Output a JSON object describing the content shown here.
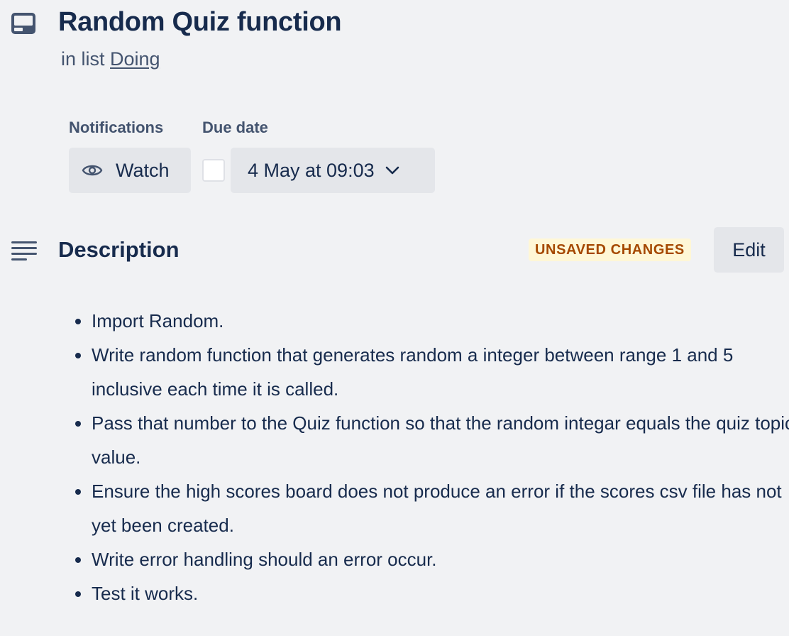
{
  "card": {
    "title": "Random Quiz function",
    "in_list_prefix": "in list",
    "list_name": "Doing",
    "icon": "card-icon"
  },
  "notifications": {
    "label": "Notifications",
    "watch_label": "Watch",
    "icon": "eye-icon"
  },
  "due_date": {
    "label": "Due date",
    "value": "4 May at 09:03",
    "checked": false,
    "icon": "chevron-down-icon"
  },
  "description": {
    "heading": "Description",
    "icon": "description-icon",
    "badge": "UNSAVED CHANGES",
    "edit_label": "Edit",
    "items": [
      "Import Random.",
      "Write random function that generates random a integer between range 1 and 5 inclusive each time it is called.",
      "Pass that number to the Quiz function so that the random integar equals the quiz topic value.",
      "Ensure the high scores board does not produce an error if the scores csv file has not yet been created.",
      "Write error handling should an error occur.",
      "Test it works."
    ]
  },
  "colors": {
    "background": "#f1f2f4",
    "text": "#172b4d",
    "subtle_text": "#44546f",
    "button_bg": "#e4e6ea",
    "badge_bg": "#fff7d6",
    "badge_text": "#a54800"
  }
}
